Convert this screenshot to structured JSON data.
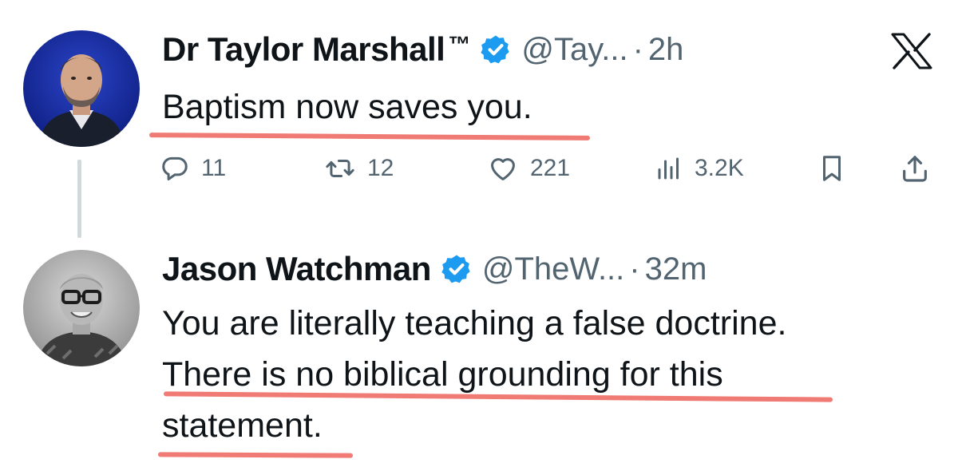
{
  "tweet1": {
    "display_name": "Dr Taylor Marshall",
    "tm": "™",
    "handle": "@Tay...",
    "separator": "·",
    "time": "2h",
    "text": "Baptism now saves you.",
    "actions": {
      "replies": "11",
      "retweets": "12",
      "likes": "221",
      "views": "3.2K"
    }
  },
  "tweet2": {
    "display_name": "Jason Watchman",
    "handle": "@TheW...",
    "separator": "·",
    "time": "32m",
    "text_line1": "You are literally teaching a false doctrine.",
    "text_line2": "There is no biblical grounding for this",
    "text_line3": "statement."
  },
  "colors": {
    "verified_blue": "#1d9bf0",
    "secondary_text": "#536471",
    "underline_highlight": "#f07a74",
    "thread_line": "#cfd9de"
  },
  "icons": {
    "x_logo": "x-logo-icon",
    "reply": "reply-icon",
    "retweet": "retweet-icon",
    "like": "heart-icon",
    "views": "views-bar-chart-icon",
    "bookmark": "bookmark-icon",
    "share": "share-icon",
    "verified": "verified-badge-icon"
  }
}
